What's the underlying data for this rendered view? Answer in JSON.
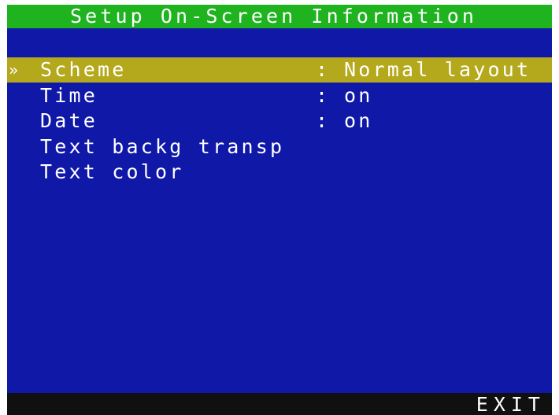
{
  "title": "Setup On-Screen Information",
  "menu": {
    "items": [
      {
        "marker": "»",
        "label": "Scheme",
        "separator": ":",
        "value": "Normal layout",
        "selected": true
      },
      {
        "marker": "",
        "label": "Time",
        "separator": ":",
        "value": "on",
        "selected": false
      },
      {
        "marker": "",
        "label": "Date",
        "separator": ":",
        "value": "on",
        "selected": false
      },
      {
        "marker": "",
        "label": "Text backg transp",
        "separator": "",
        "value": "",
        "selected": false
      },
      {
        "marker": "",
        "label": "Text color",
        "separator": "",
        "value": "",
        "selected": false
      }
    ]
  },
  "footer": {
    "exit_label": "EXIT"
  },
  "colors": {
    "title_bar": "#1fb41f",
    "menu_background": "#1018a8",
    "selected_row": "#b4a81c",
    "footer_bar": "#101010",
    "text": "#ffffff"
  }
}
